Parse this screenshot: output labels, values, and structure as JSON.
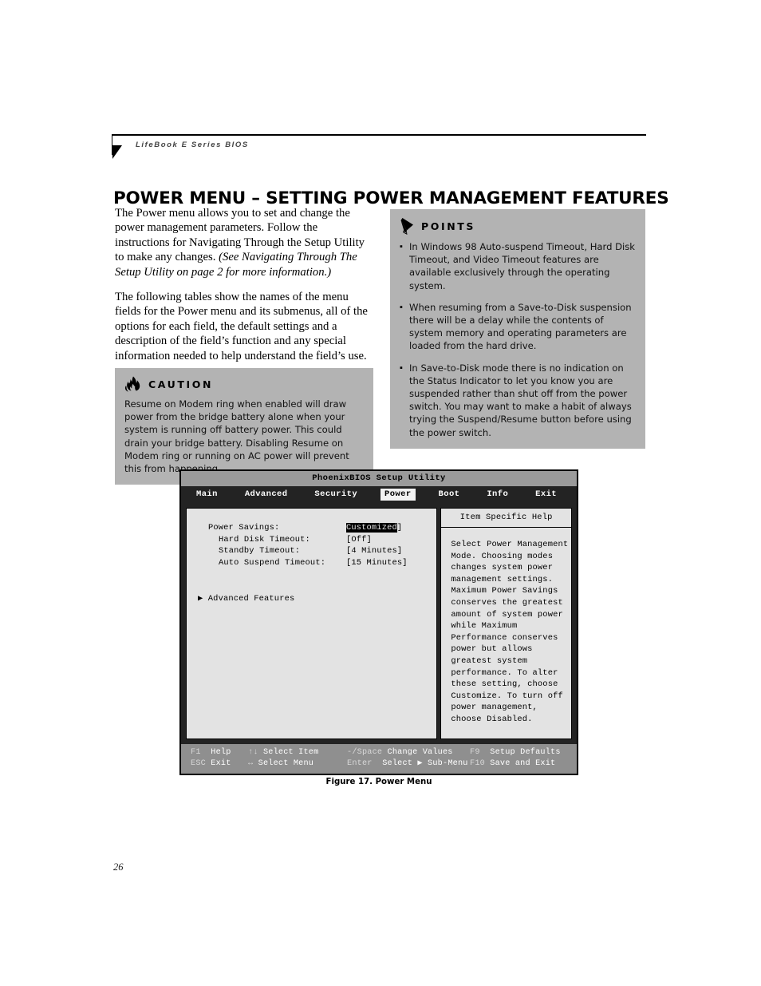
{
  "header": {
    "running_title": "LifeBook E Series BIOS"
  },
  "page_title": "POWER MENU – SETTING POWER MANAGEMENT FEATURES",
  "body": {
    "para1_plain": "The Power menu allows you to set and change the power management parameters. Follow the instructions for Navigating Through the Setup Utility to make any changes. ",
    "para1_italic": "(See Navigating Through The Setup Utility on page 2 for more information.)",
    "para2": "The following tables show the names of the menu fields for the Power menu and its submenus, all of the options for each field, the default settings and a description of the field’s function and any special information needed to help understand the field’s use."
  },
  "caution": {
    "icon": "flame-icon",
    "label": "CAUTION",
    "text": "Resume on Modem ring when enabled will draw power from the bridge battery alone when your system is running off battery power. This could drain your bridge battery. Disabling Resume on Modem ring or running on AC power will prevent this from happening."
  },
  "points": {
    "icon": "pencil-icon",
    "label": "POINTS",
    "bullet": "▪",
    "items": [
      "In Windows 98 Auto-suspend Timeout, Hard Disk Timeout, and Video Timeout features are available exclusively through the operating system.",
      "When resuming from a Save-to-Disk suspension there will be a delay while the contents of system memory and operating parameters are loaded from the hard drive.",
      "In Save-to-Disk mode there is no indication on the Status Indicator to let you know you are suspended rather than shut off from the power switch. You may want to make a habit of always trying the Suspend/Resume button before using the power switch."
    ]
  },
  "bios": {
    "title": "PhoenixBIOS Setup Utility",
    "menu": [
      {
        "label": "Main",
        "selected": false
      },
      {
        "label": "Advanced",
        "selected": false
      },
      {
        "label": "Security",
        "selected": false
      },
      {
        "label": "Power",
        "selected": true
      },
      {
        "label": "Boot",
        "selected": false
      },
      {
        "label": "Info",
        "selected": false
      },
      {
        "label": "Exit",
        "selected": false
      }
    ],
    "settings": [
      {
        "label": "Power Savings:",
        "value": "Customized",
        "highlighted": true,
        "indent": 0
      },
      {
        "label": "Hard Disk Timeout:",
        "value": "Off",
        "highlighted": false,
        "indent": 1
      },
      {
        "label": "Standby Timeout:",
        "value": "4 Minutes",
        "highlighted": false,
        "indent": 1
      },
      {
        "label": "Auto Suspend Timeout:",
        "value": "15 Minutes",
        "highlighted": false,
        "indent": 1
      }
    ],
    "submenu": {
      "arrow": "▶",
      "label": "Advanced Features"
    },
    "help_title": "Item Specific Help",
    "help_text": "Select Power Management\nMode. Choosing modes\nchanges system power\nmanagement settings.\nMaximum Power Savings\nconserves the greatest\namount of system power\nwhile Maximum\nPerformance conserves\npower but allows\ngreatest system\nperformance. To alter\nthese setting, choose\nCustomize. To turn off\npower management,\nchoose Disabled.",
    "footer": {
      "row1": [
        {
          "key": "F1",
          "label": "Help"
        },
        {
          "key": "↑↓",
          "label": "Select Item"
        },
        {
          "key": "-/Space",
          "label": "Change Values"
        },
        {
          "key": "F9",
          "label": "Setup Defaults"
        }
      ],
      "row2": [
        {
          "key": "ESC",
          "label": "Exit"
        },
        {
          "key": "↔",
          "label": "Select Menu"
        },
        {
          "key": "Enter",
          "label": "Select ▶ Sub-Menu"
        },
        {
          "key": "F10",
          "label": "Save and Exit"
        }
      ]
    }
  },
  "figure_caption": "Figure 17.  Power Menu",
  "page_number": "26",
  "colors": {
    "box_gray": "#b3b3b3",
    "bios_titlebar": "#9b9b9b",
    "bios_menubar": "#232323",
    "bios_panel": "#e3e3e3",
    "bios_footer": "#8f8f8f"
  }
}
